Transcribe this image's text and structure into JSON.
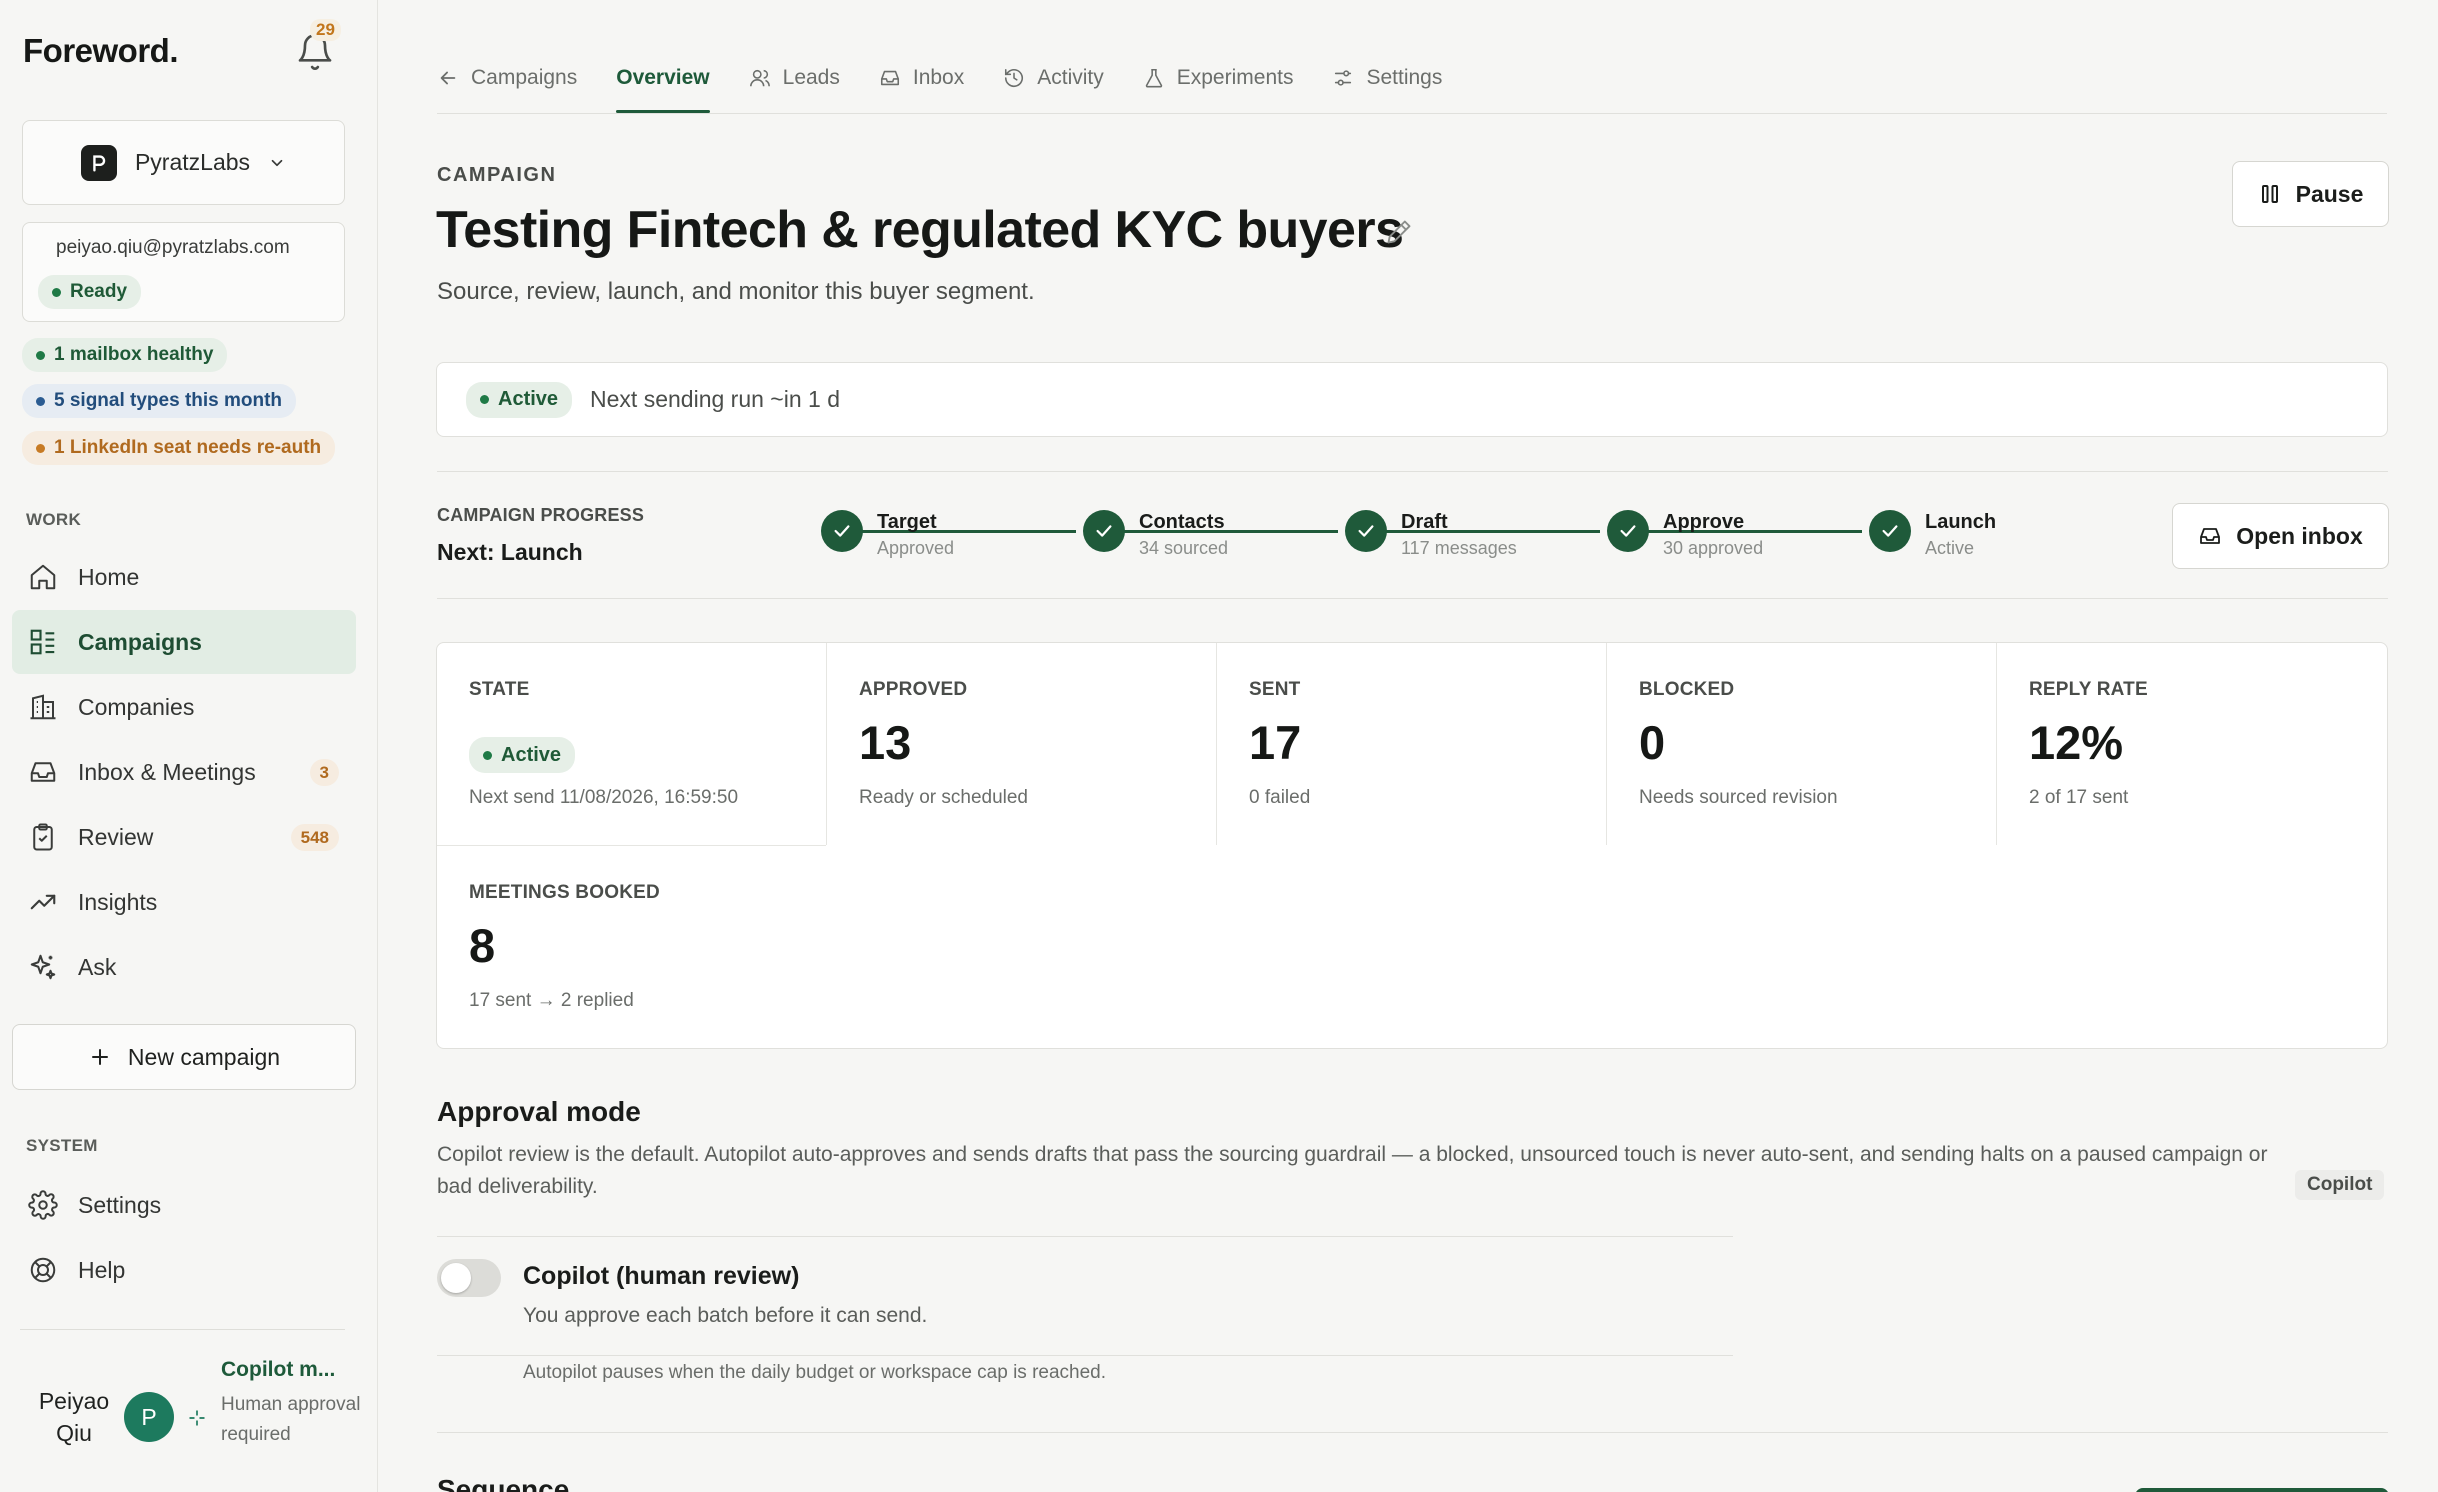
{
  "app": {
    "logo": "Foreword.",
    "notifications": "29"
  },
  "workspace": {
    "name": "PyratzLabs"
  },
  "account": {
    "email": "peiyao.qiu@pyratzlabs.com",
    "status": "Ready"
  },
  "health": [
    {
      "text": "1 mailbox healthy",
      "tone": "green"
    },
    {
      "text": "5 signal types this month",
      "tone": "blue"
    },
    {
      "text": "1 LinkedIn seat needs re-auth",
      "tone": "amber"
    }
  ],
  "sidebar": {
    "work_label": "WORK",
    "items": [
      {
        "label": "Home",
        "icon": "home-icon"
      },
      {
        "label": "Campaigns",
        "icon": "campaigns-icon",
        "active": true
      },
      {
        "label": "Companies",
        "icon": "building-icon"
      },
      {
        "label": "Inbox & Meetings",
        "icon": "inbox-icon",
        "badge": "3"
      },
      {
        "label": "Review",
        "icon": "clipboard-icon",
        "badge": "548"
      },
      {
        "label": "Insights",
        "icon": "trend-icon"
      },
      {
        "label": "Ask",
        "icon": "sparkle-icon"
      }
    ],
    "new_campaign": "New campaign",
    "system_label": "SYSTEM",
    "system_items": [
      {
        "label": "Settings",
        "icon": "gear-icon"
      },
      {
        "label": "Help",
        "icon": "lifebuoy-icon"
      }
    ]
  },
  "user": {
    "name": "Peiyao Qiu",
    "initial": "P",
    "mode_title": "Copilot m...",
    "mode_desc": "Human approval required"
  },
  "tabs": [
    {
      "label": "Campaigns",
      "icon": "arrow-left-icon"
    },
    {
      "label": "Overview",
      "active": true
    },
    {
      "label": "Leads",
      "icon": "users-icon"
    },
    {
      "label": "Inbox",
      "icon": "inbox-icon"
    },
    {
      "label": "Activity",
      "icon": "history-icon"
    },
    {
      "label": "Experiments",
      "icon": "flask-icon"
    },
    {
      "label": "Settings",
      "icon": "sliders-icon"
    }
  ],
  "campaign": {
    "eyebrow": "CAMPAIGN",
    "title": "Testing Fintech & regulated KYC buyers",
    "subtitle": "Source, review, launch, and monitor this buyer segment.",
    "pause": "Pause",
    "status": "Active",
    "next_run": "Next sending run ~in 1 d"
  },
  "progress": {
    "label": "CAMPAIGN PROGRESS",
    "next": "Next: Launch",
    "open_inbox": "Open inbox",
    "steps": [
      {
        "name": "Target",
        "sub": "Approved"
      },
      {
        "name": "Contacts",
        "sub": "34 sourced"
      },
      {
        "name": "Draft",
        "sub": "117 messages"
      },
      {
        "name": "Approve",
        "sub": "30 approved"
      },
      {
        "name": "Launch",
        "sub": "Active"
      }
    ]
  },
  "stats": {
    "state": {
      "label": "STATE",
      "value": "Active",
      "sub": "Next send 11/08/2026, 16:59:50"
    },
    "approved": {
      "label": "APPROVED",
      "value": "13",
      "sub": "Ready or scheduled"
    },
    "sent": {
      "label": "SENT",
      "value": "17",
      "sub": "0 failed"
    },
    "blocked": {
      "label": "BLOCKED",
      "value": "0",
      "sub": "Needs sourced revision"
    },
    "reply_rate": {
      "label": "REPLY RATE",
      "value": "12%",
      "sub": "2 of 17 sent"
    },
    "meetings": {
      "label": "MEETINGS BOOKED",
      "value": "8",
      "sub": "17 sent → 2 replied"
    }
  },
  "approval": {
    "heading": "Approval mode",
    "description": "Copilot review is the default. Autopilot auto-approves and sends drafts that pass the sourcing guardrail — a blocked, unsourced touch is never auto-sent, and sending halts on a paused campaign or bad deliverability.",
    "mode_tag": "Copilot",
    "toggle_title": "Copilot (human review)",
    "toggle_desc": "You approve each batch before it can send.",
    "toggle_on": false,
    "note": "Autopilot pauses when the daily budget or workspace cap is reached."
  },
  "sequence": {
    "heading": "Sequence"
  }
}
